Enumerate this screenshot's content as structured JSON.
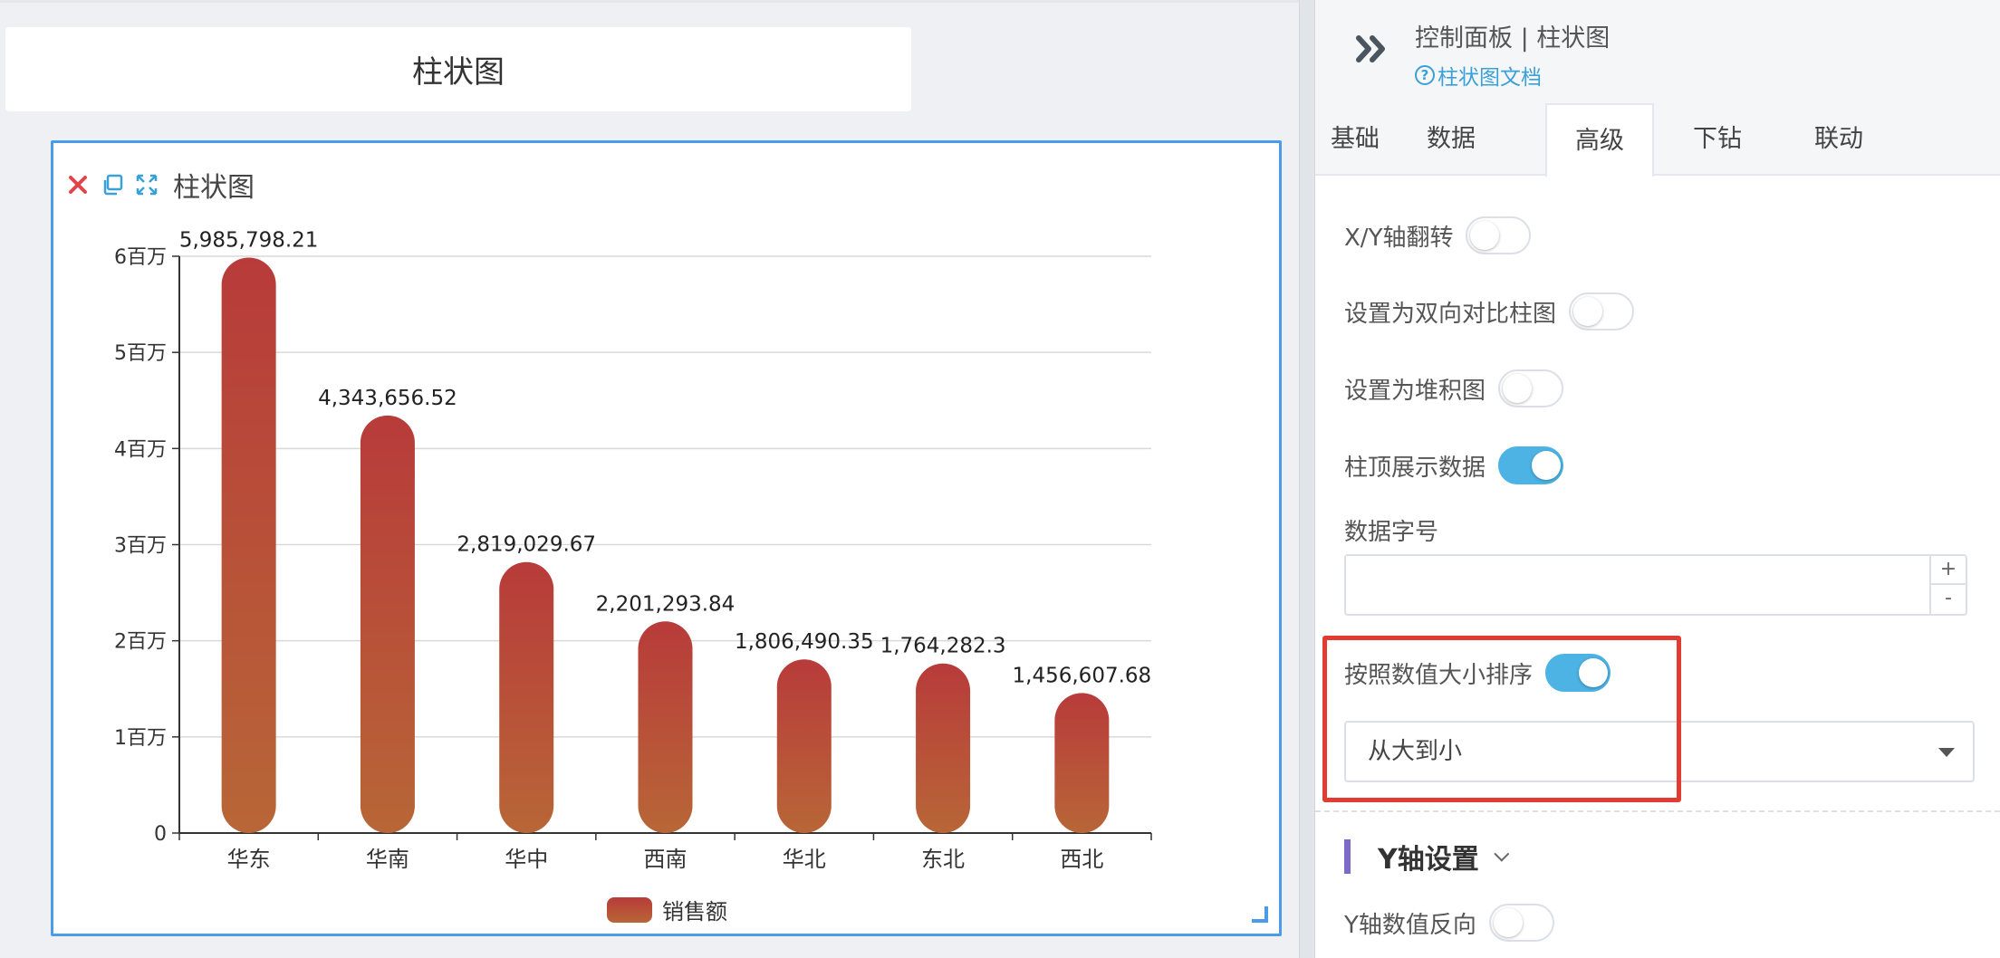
{
  "canvas": {
    "page_title": "柱状图",
    "chart_card": {
      "title": "柱状图",
      "icons": [
        "close-icon",
        "copy-icon",
        "fullscreen-icon"
      ]
    }
  },
  "chart_data": {
    "type": "bar",
    "title": "",
    "categories": [
      "华东",
      "华南",
      "华中",
      "西南",
      "华北",
      "东北",
      "西北"
    ],
    "series": [
      {
        "name": "销售额",
        "values": [
          5985798.21,
          4343656.52,
          2819029.67,
          2201293.84,
          1806490.35,
          1764282.3,
          1456607.68
        ],
        "labels": [
          "5,985,798.21",
          "4,343,656.52",
          "2,819,029.67",
          "2,201,293.84",
          "1,806,490.35",
          "1,764,282.3",
          "1,456,607.68"
        ]
      }
    ],
    "y_ticks": [
      "0",
      "1百万",
      "2百万",
      "3百万",
      "4百万",
      "5百万",
      "6百万"
    ],
    "ylim": [
      0,
      6000000
    ],
    "grid": true,
    "legend": "bottom-center",
    "bar_color_top": "#b83b3a",
    "bar_color_bottom": "#b86637"
  },
  "panel": {
    "title": "控制面板 | 柱状图",
    "doc_link": "柱状图文档",
    "doc_icon": "?",
    "tabs": [
      "基础",
      "数据",
      "高级",
      "下钻",
      "联动"
    ],
    "active_tab": "高级",
    "options": [
      {
        "label": "X/Y轴翻转",
        "on": false
      },
      {
        "label": "设置为双向对比柱图",
        "on": false
      },
      {
        "label": "设置为堆积图",
        "on": false
      },
      {
        "label": "柱顶展示数据",
        "on": true
      }
    ],
    "font_size_label": "数据字号",
    "font_size_value": "",
    "stepper_plus": "+",
    "stepper_minus": "-",
    "sort_label": "按照数值大小排序",
    "sort_on": true,
    "sort_value": "从大到小",
    "y_axis_title": "Y轴设置",
    "y_axis_reverse_label": "Y轴数值反向",
    "y_axis_reverse_on": false,
    "accent_color": "#4cb3e4",
    "highlight_color": "#e23b32"
  }
}
